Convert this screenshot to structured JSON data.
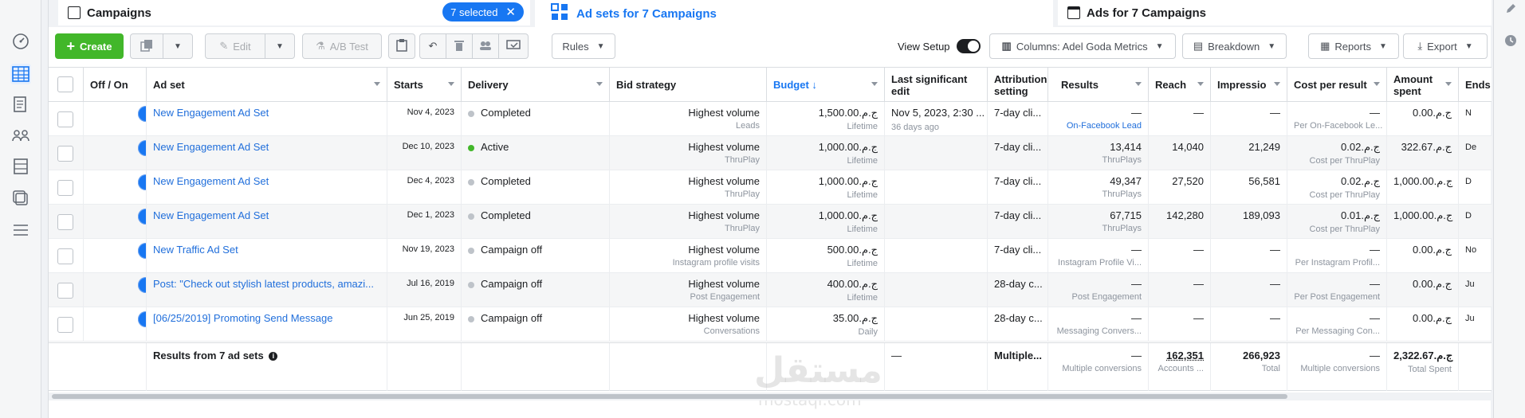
{
  "tabs": {
    "campaigns": "Campaigns",
    "selected": "7 selected",
    "adsets": "Ad sets for 7 Campaigns",
    "ads": "Ads for 7 Campaigns"
  },
  "toolbar": {
    "create": "Create",
    "edit": "Edit",
    "abtest": "A/B Test",
    "rules": "Rules",
    "view_setup": "View Setup",
    "columns": "Columns: Adel Goda Metrics",
    "breakdown": "Breakdown",
    "reports": "Reports",
    "export": "Export"
  },
  "headers": {
    "offon": "Off / On",
    "adset": "Ad set",
    "starts": "Starts",
    "delivery": "Delivery",
    "bid": "Bid strategy",
    "budget": "Budget ↓",
    "lastedit": "Last significant edit",
    "attribution": "Attribution setting",
    "results": "Results",
    "reach": "Reach",
    "impressions": "Impressio",
    "cpr": "Cost per result",
    "spent": "Amount spent",
    "ends": "Ends"
  },
  "rows": [
    {
      "name": "New Engagement Ad Set",
      "starts": "Nov 4, 2023",
      "delivery": "Completed",
      "status": "gray",
      "bid": "Highest volume",
      "bidsub": "Leads",
      "budget": "ج.م.1,500.00",
      "budgetsub": "Lifetime",
      "lastedit": "Nov 5, 2023, 2:30 ...",
      "lasteditsub": "36 days ago",
      "attr": "7-day cli...",
      "results": "—",
      "resultssub": "On-Facebook Lead",
      "reach": "—",
      "impr": "—",
      "cpr": "—",
      "cprsub": "Per On-Facebook Le...",
      "spent": "ج.م.0.00",
      "ends": "N"
    },
    {
      "name": "New Engagement Ad Set",
      "starts": "Dec 10, 2023",
      "delivery": "Active",
      "status": "green",
      "bid": "Highest volume",
      "bidsub": "ThruPlay",
      "budget": "ج.م.1,000.00",
      "budgetsub": "Lifetime",
      "lastedit": "",
      "lasteditsub": "",
      "attr": "7-day cli...",
      "results": "13,414",
      "resultssub": "ThruPlays",
      "reach": "14,040",
      "impr": "21,249",
      "cpr": "ج.م.0.02",
      "cprsub": "Cost per ThruPlay",
      "spent": "ج.م.322.67",
      "ends": "De"
    },
    {
      "name": "New Engagement Ad Set",
      "starts": "Dec 4, 2023",
      "delivery": "Completed",
      "status": "gray",
      "bid": "Highest volume",
      "bidsub": "ThruPlay",
      "budget": "ج.م.1,000.00",
      "budgetsub": "Lifetime",
      "lastedit": "",
      "lasteditsub": "",
      "attr": "7-day cli...",
      "results": "49,347",
      "resultssub": "ThruPlays",
      "reach": "27,520",
      "impr": "56,581",
      "cpr": "ج.م.0.02",
      "cprsub": "Cost per ThruPlay",
      "spent": "ج.م.1,000.00",
      "ends": "D"
    },
    {
      "name": "New Engagement Ad Set",
      "starts": "Dec 1, 2023",
      "delivery": "Completed",
      "status": "gray",
      "bid": "Highest volume",
      "bidsub": "ThruPlay",
      "budget": "ج.م.1,000.00",
      "budgetsub": "Lifetime",
      "lastedit": "",
      "lasteditsub": "",
      "attr": "7-day cli...",
      "results": "67,715",
      "resultssub": "ThruPlays",
      "reach": "142,280",
      "impr": "189,093",
      "cpr": "ج.م.0.01",
      "cprsub": "Cost per ThruPlay",
      "spent": "ج.م.1,000.00",
      "ends": "D"
    },
    {
      "name": "New Traffic Ad Set",
      "starts": "Nov 19, 2023",
      "delivery": "Campaign off",
      "status": "gray",
      "bid": "Highest volume",
      "bidsub": "Instagram profile visits",
      "budget": "ج.م.500.00",
      "budgetsub": "Lifetime",
      "lastedit": "",
      "lasteditsub": "",
      "attr": "7-day cli...",
      "results": "—",
      "resultssub": "Instagram Profile Vi...",
      "reach": "—",
      "impr": "—",
      "cpr": "—",
      "cprsub": "Per Instagram Profil...",
      "spent": "ج.م.0.00",
      "ends": "No"
    },
    {
      "name": "Post: \"Check out stylish latest products, amazi...",
      "starts": "Jul 16, 2019",
      "delivery": "Campaign off",
      "status": "gray",
      "bid": "Highest volume",
      "bidsub": "Post Engagement",
      "budget": "ج.م.400.00",
      "budgetsub": "Lifetime",
      "lastedit": "",
      "lasteditsub": "",
      "attr": "28-day c...",
      "results": "—",
      "resultssub": "Post Engagement",
      "reach": "—",
      "impr": "—",
      "cpr": "—",
      "cprsub": "Per Post Engagement",
      "spent": "ج.م.0.00",
      "ends": "Ju"
    },
    {
      "name": "[06/25/2019] Promoting Send Message",
      "starts": "Jun 25, 2019",
      "delivery": "Campaign off",
      "status": "gray",
      "bid": "Highest volume",
      "bidsub": "Conversations",
      "budget": "ج.م.35.00",
      "budgetsub": "Daily",
      "lastedit": "",
      "lasteditsub": "",
      "attr": "28-day c...",
      "results": "—",
      "resultssub": "Messaging Convers...",
      "reach": "—",
      "impr": "—",
      "cpr": "—",
      "cprsub": "Per Messaging Con...",
      "spent": "ج.م.0.00",
      "ends": "Ju"
    }
  ],
  "totals": {
    "label": "Results from 7 ad sets",
    "lastedit": "—",
    "attr": "Multiple...",
    "results": "—",
    "resultssub": "Multiple conversions",
    "reach": "162,351",
    "reachsub": "Accounts ...",
    "impr": "266,923",
    "imprsub": "Total",
    "cpr": "—",
    "cprsub": "Multiple conversions",
    "spent": "ج.م.2,322.67",
    "spentsub": "Total Spent"
  },
  "watermark": {
    "ar": "مستقل",
    "en": "mostaql.com"
  }
}
